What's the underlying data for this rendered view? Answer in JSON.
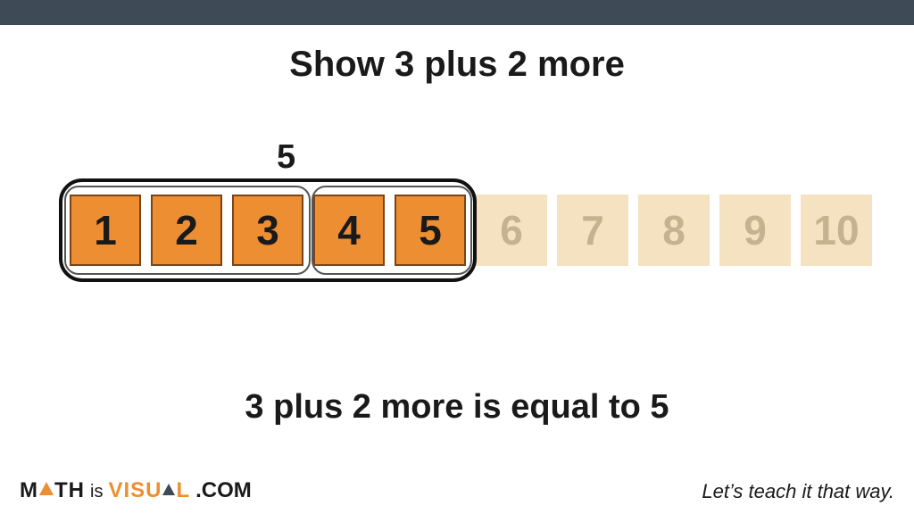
{
  "title": "Show 3 plus 2 more",
  "sum_label": "5",
  "tiles": [
    "1",
    "2",
    "3",
    "4",
    "5",
    "6",
    "7",
    "8",
    "9",
    "10"
  ],
  "active_count": 5,
  "group1_count": 3,
  "group2_count": 2,
  "answer": "3 plus 2 more is equal to 5",
  "logo": {
    "word1_pre": "M",
    "word1_post": "TH",
    "is": "is",
    "visual_pre": "VISU",
    "visual_post": "L",
    "com": ".COM"
  },
  "tagline": "Let’s teach it that way."
}
